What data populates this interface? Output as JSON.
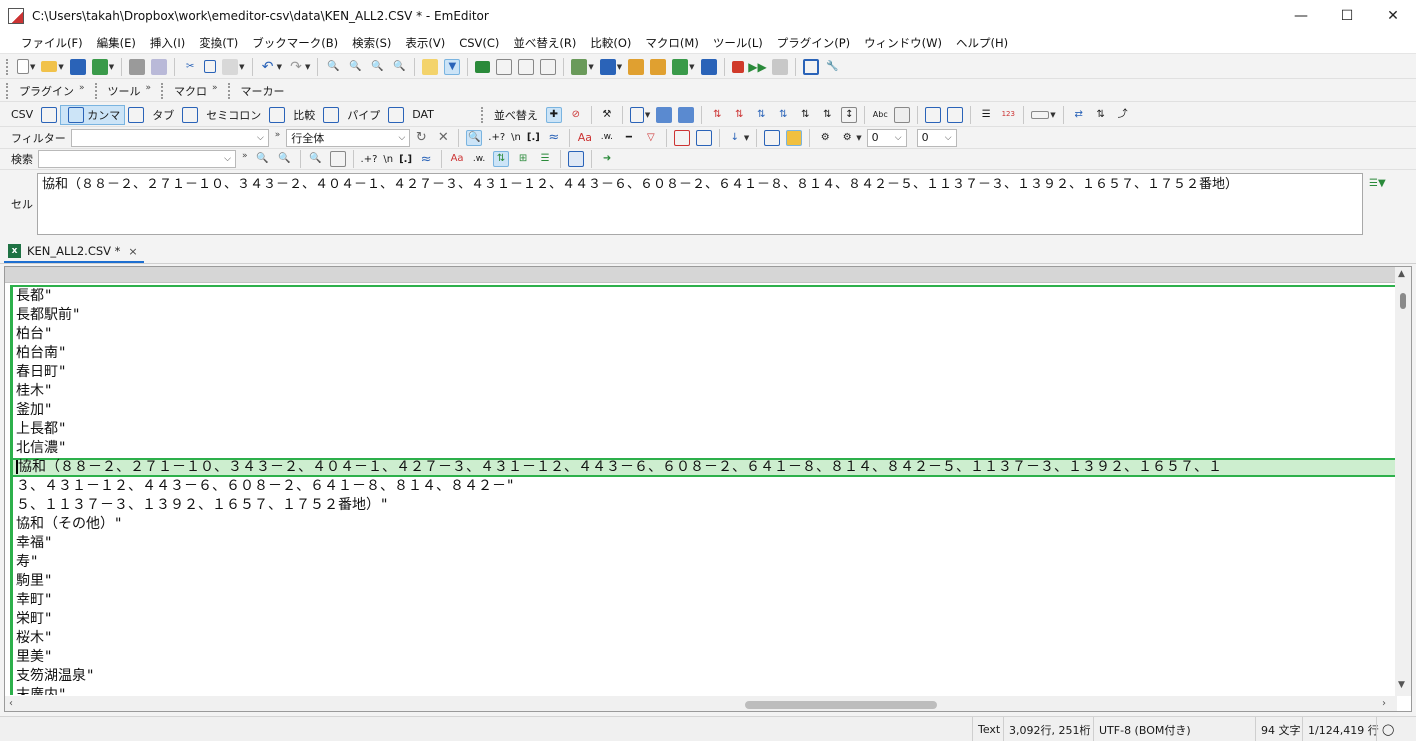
{
  "window": {
    "title": "C:\\Users\\takah\\Dropbox\\work\\emeditor-csv\\data\\KEN_ALL2.CSV * - EmEditor",
    "minimize": "—",
    "maximize": "☐",
    "close": "✕"
  },
  "menu": [
    "ファイル(F)",
    "編集(E)",
    "挿入(I)",
    "変換(T)",
    "ブックマーク(B)",
    "検索(S)",
    "表示(V)",
    "CSV(C)",
    "並べ替え(R)",
    "比較(O)",
    "マクロ(M)",
    "ツール(L)",
    "プラグイン(P)",
    "ウィンドウ(W)",
    "ヘルプ(H)"
  ],
  "toolbar3": {
    "plugin": "プラグイン",
    "tools": "ツール",
    "macro": "マクロ",
    "marker": "マーカー"
  },
  "csvbar": {
    "csv": "CSV",
    "comma": "カンマ",
    "tab": "タブ",
    "semicolon": "セミコロン",
    "compare": "比較",
    "pipe": "パイプ",
    "dat": "DAT",
    "sort": "並べ替え"
  },
  "filterbar": {
    "label": "フィルター",
    "filter_value": "",
    "scope": "行全体",
    "regex_dot": ".+?",
    "newline": "\\n",
    "brackets": "[.]",
    "num1": "0",
    "num2": "0"
  },
  "searchbar": {
    "label": "検索",
    "value": "",
    "regex_dot": ".+?",
    "newline": "\\n",
    "brackets": "[.]"
  },
  "cell": {
    "label": "セル",
    "value": "協和（８８－２、２７１－１０、３４３－２、４０４－１、４２７－３、４３１－１２、４４３－６、６０８－２、６４１－８、８１４、８４２－５、１１３７－３、１３９２、１６５７、１７５２番地）"
  },
  "tab": {
    "name": "KEN_ALL2.CSV *",
    "close": "×"
  },
  "lines": [
    "長都\"",
    "長都駅前\"",
    "柏台\"",
    "柏台南\"",
    "春日町\"",
    "桂木\"",
    "釜加\"",
    "上長都\"",
    "北信濃\"",
    "協和（８８－２、２７１－１０、３４３－２、４０４－１、４２７－３、４３１－１２、４４３－６、６０８－２、６４１－８、８１４、８４２－５、１１３７－３、１３９２、１６５７、１",
    "３、４３１－１２、４４３－６、６０８－２、６４１－８、８１４、８４２－\"",
    "５、１１３７－３、１３９２、１６５７、１７５２番地）\"",
    "協和（その他）\"",
    "幸福\"",
    "寿\"",
    "駒里\"",
    "幸町\"",
    "栄町\"",
    "桜木\"",
    "里美\"",
    "支笏湖温泉\"",
    "末廣内\""
  ],
  "current_line_index": 9,
  "status": {
    "mode": "Text",
    "position": "3,092行, 251桁",
    "encoding": "UTF-8 (BOM付き)",
    "chars": "94 文字",
    "line_count": "1/124,419 行",
    "feedback_icon": "speech-bubble-icon"
  },
  "colors": {
    "selection_border": "#2db04b",
    "current_line_bg": "#cdeecf",
    "tab_accent": "#1e6fd0"
  }
}
